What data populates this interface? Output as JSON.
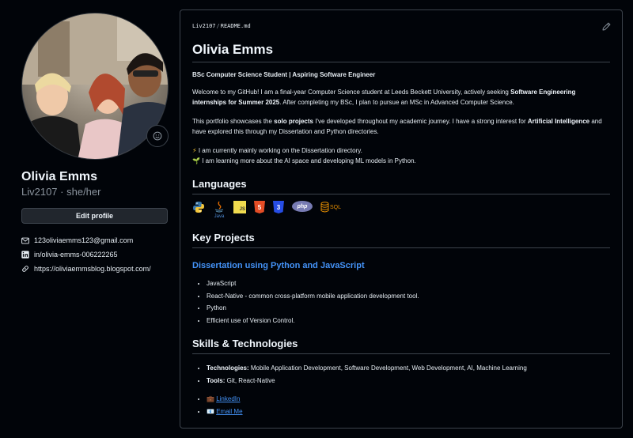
{
  "profile": {
    "display_name": "Olivia Emms",
    "username": "Liv2107",
    "separator": " · ",
    "pronouns": "she/her",
    "edit_label": "Edit profile",
    "links": [
      {
        "icon": "mail-icon",
        "text": "123oliviaemms123@gmail.com"
      },
      {
        "icon": "linkedin-icon",
        "text": "in/olivia-emms-006222265"
      },
      {
        "icon": "link-icon",
        "text": "https://oliviaemmsblog.blogspot.com/"
      }
    ]
  },
  "readme": {
    "crumb_user": "Liv2107",
    "crumb_sep": "/",
    "crumb_file": "README",
    "crumb_ext": ".md",
    "title": "Olivia Emms",
    "tagline": "BSc Computer Science Student | Aspiring Software Engineer",
    "intro": {
      "before": "Welcome to my GitHub! I am a final-year Computer Science student at Leeds Beckett University, actively seeking ",
      "bold": "Software Engineering internships for Summer 2025",
      "after": ". After completing my BSc, I plan to pursue an MSc in Advanced Computer Science."
    },
    "portfolio": {
      "p1": "This portfolio showcases the ",
      "b1": "solo projects",
      "p2": " I've developed throughout my academic journey. I have a strong interest for ",
      "b2": "Artificial Intelligence",
      "p3": " and have explored this through my Dissertation and Python directories."
    },
    "status_lines": [
      {
        "emoji": "⚡",
        "text": "I am currently mainly working on the Dissertation directory."
      },
      {
        "emoji": "🌱",
        "text": "I am learning more about the AI space and developing ML models in Python."
      }
    ],
    "languages_heading": "Languages",
    "languages": [
      {
        "icon": "python-icon",
        "label": ""
      },
      {
        "icon": "java-icon",
        "label": "Java"
      },
      {
        "icon": "javascript-icon",
        "label": "JS"
      },
      {
        "icon": "html5-icon",
        "label": "5"
      },
      {
        "icon": "css3-icon",
        "label": "3"
      },
      {
        "icon": "php-icon",
        "label": "php"
      },
      {
        "icon": "sql-icon",
        "label": "SQL"
      }
    ],
    "projects_heading": "Key Projects",
    "project_title": "Dissertation using Python and JavaScript",
    "project_items": [
      "JavaScript",
      "React-Native - common cross-platform mobile application development tool.",
      "Python",
      "Efficient use of Version Control."
    ],
    "skills_heading": "Skills & Technologies",
    "skills": [
      {
        "label": "Technologies:",
        "text": " Mobile Application Development, Software Development, Web Development, AI, Machine Learning"
      },
      {
        "label": "Tools:",
        "text": " Git, React-Native"
      }
    ],
    "contact_links": [
      {
        "emoji": "💼",
        "text": "LinkedIn"
      },
      {
        "emoji": "📧",
        "text": "Email Me"
      }
    ]
  },
  "colors": {
    "background": "#010409",
    "border": "#3d444d",
    "link": "#4493f8",
    "text": "#e6edf3",
    "muted": "#8b949e"
  }
}
